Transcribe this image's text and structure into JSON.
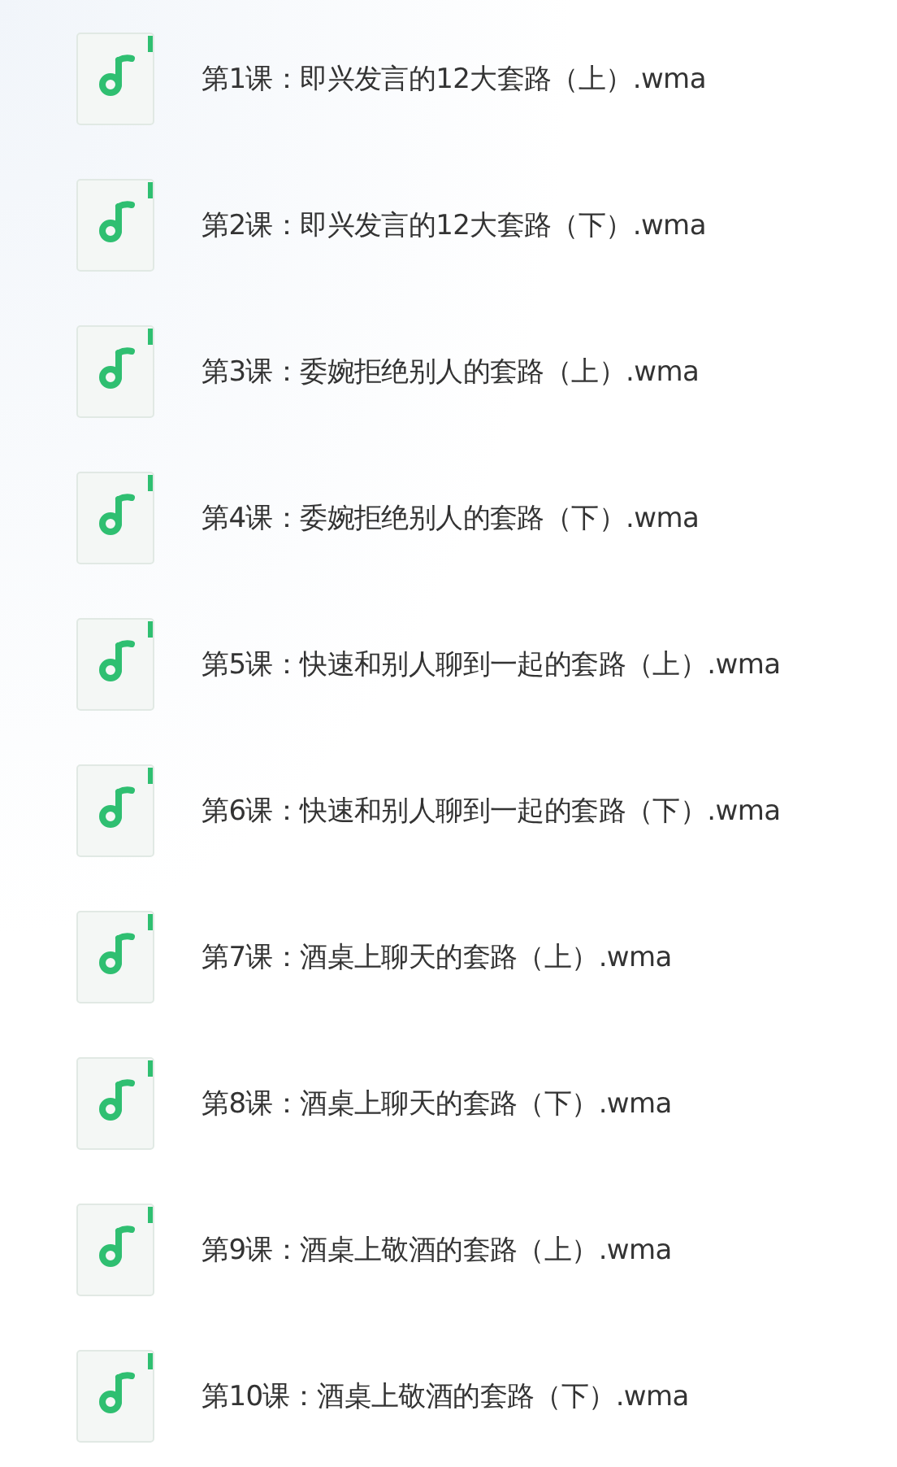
{
  "files": [
    {
      "name": "第1课：即兴发言的12大套路（上）.wma"
    },
    {
      "name": "第2课：即兴发言的12大套路（下）.wma"
    },
    {
      "name": "第3课：委婉拒绝别人的套路（上）.wma"
    },
    {
      "name": "第4课：委婉拒绝别人的套路（下）.wma"
    },
    {
      "name": "第5课：快速和别人聊到一起的套路（上）.wma"
    },
    {
      "name": "第6课：快速和别人聊到一起的套路（下）.wma"
    },
    {
      "name": "第7课：酒桌上聊天的套路（上）.wma"
    },
    {
      "name": "第8课：酒桌上聊天的套路（下）.wma"
    },
    {
      "name": "第9课：酒桌上敬酒的套路（上）.wma"
    },
    {
      "name": "第10课：酒桌上敬酒的套路（下）.wma"
    }
  ]
}
